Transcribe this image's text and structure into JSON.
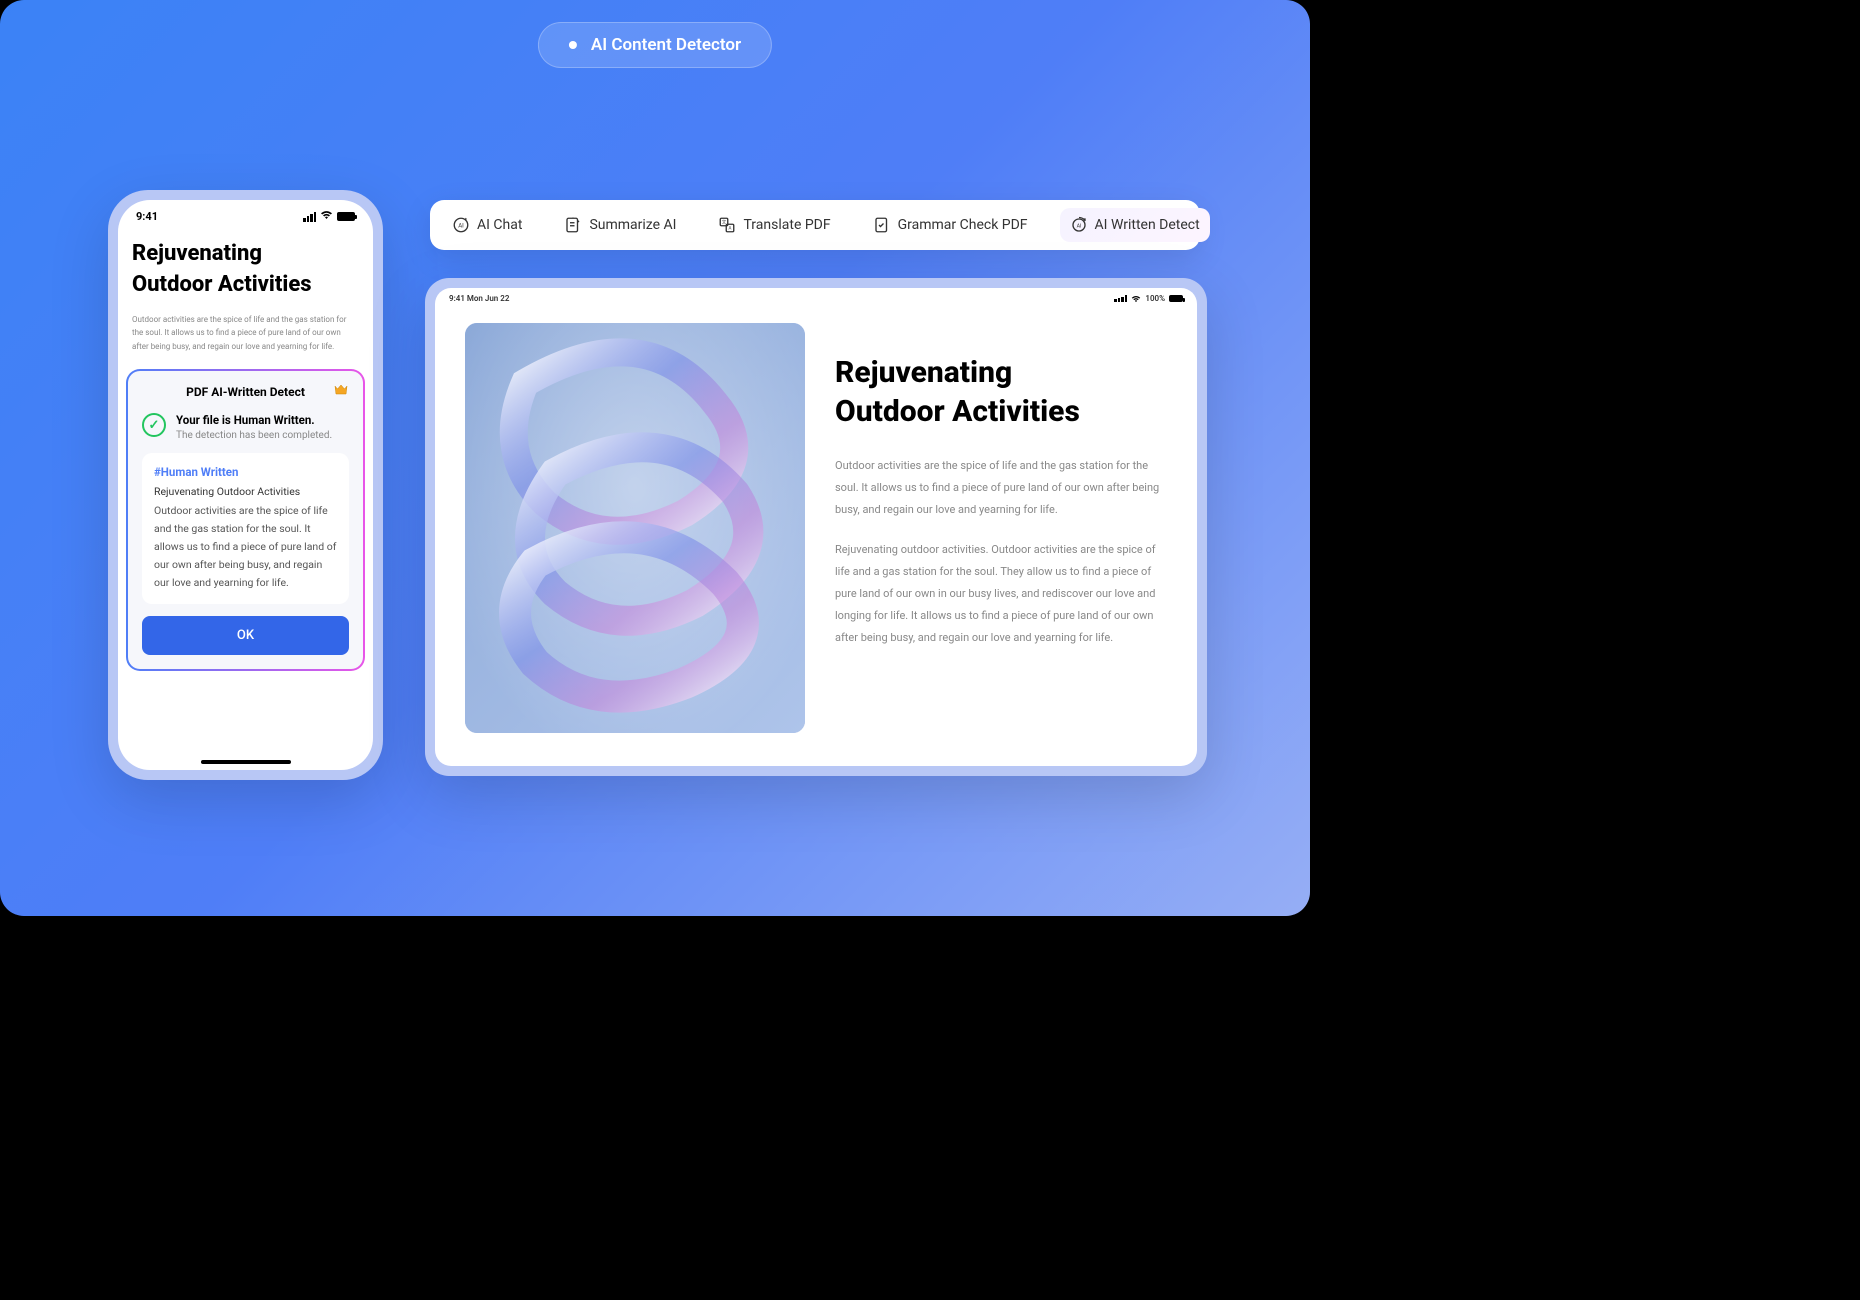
{
  "header": {
    "label": "AI  Content Detector"
  },
  "tabs": [
    {
      "label": "AI Chat"
    },
    {
      "label": "Summarize AI"
    },
    {
      "label": "Translate PDF"
    },
    {
      "label": "Grammar Check PDF"
    },
    {
      "label": "AI Written Detect"
    }
  ],
  "phone": {
    "statusbar": {
      "time": "9:41"
    },
    "title_line1": "Rejuvenating",
    "title_line2": "Outdoor Activities",
    "body": "Outdoor activities are the spice of life and the gas station for the soul. It allows us to find a piece of pure land of our own after being busy, and regain our love and yearning for life.",
    "card": {
      "header": "PDF AI-Written Detect",
      "result_title": "Your file is Human Written.",
      "result_sub": "The detection has been completed.",
      "tag": "#Human Written",
      "small_title": "Rejuvenating Outdoor Activities",
      "body": "Outdoor activities are the spice of life and the gas station for the soul. It allows us to find a piece of pure land of our own after being busy, and regain our love and yearning for life.",
      "ok_label": "OK"
    }
  },
  "tablet": {
    "statusbar": {
      "time": "9:41  Mon Jun 22",
      "battery": "100%"
    },
    "title_line1": "Rejuvenating",
    "title_line2": "Outdoor Activities",
    "para1": "Outdoor activities are the spice of life and the gas station for the soul. It allows us to find a piece of pure land of our own after being busy, and regain our love and yearning for life.",
    "para2": "Rejuvenating outdoor activities. Outdoor activities are the spice of life and a gas station for the soul. They allow us to find a piece of pure land of our own in our busy lives, and rediscover our love and longing for life. It allows us to find a piece of pure land of our own after being busy, and regain our love and yearning for life."
  }
}
